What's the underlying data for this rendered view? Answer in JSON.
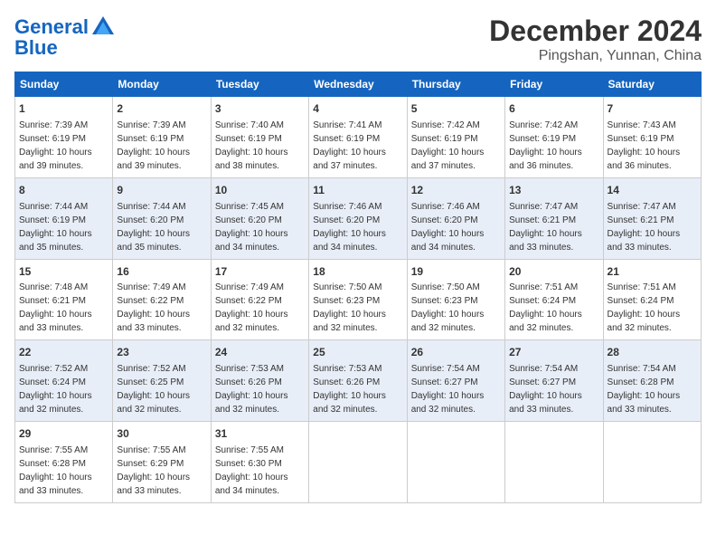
{
  "logo": {
    "line1": "General",
    "line2": "Blue"
  },
  "title": "December 2024",
  "subtitle": "Pingshan, Yunnan, China",
  "days_of_week": [
    "Sunday",
    "Monday",
    "Tuesday",
    "Wednesday",
    "Thursday",
    "Friday",
    "Saturday"
  ],
  "weeks": [
    [
      {
        "day": "1",
        "sunrise": "7:39 AM",
        "sunset": "6:19 PM",
        "daylight": "10 hours and 39 minutes."
      },
      {
        "day": "2",
        "sunrise": "7:39 AM",
        "sunset": "6:19 PM",
        "daylight": "10 hours and 39 minutes."
      },
      {
        "day": "3",
        "sunrise": "7:40 AM",
        "sunset": "6:19 PM",
        "daylight": "10 hours and 38 minutes."
      },
      {
        "day": "4",
        "sunrise": "7:41 AM",
        "sunset": "6:19 PM",
        "daylight": "10 hours and 37 minutes."
      },
      {
        "day": "5",
        "sunrise": "7:42 AM",
        "sunset": "6:19 PM",
        "daylight": "10 hours and 37 minutes."
      },
      {
        "day": "6",
        "sunrise": "7:42 AM",
        "sunset": "6:19 PM",
        "daylight": "10 hours and 36 minutes."
      },
      {
        "day": "7",
        "sunrise": "7:43 AM",
        "sunset": "6:19 PM",
        "daylight": "10 hours and 36 minutes."
      }
    ],
    [
      {
        "day": "8",
        "sunrise": "7:44 AM",
        "sunset": "6:19 PM",
        "daylight": "10 hours and 35 minutes."
      },
      {
        "day": "9",
        "sunrise": "7:44 AM",
        "sunset": "6:20 PM",
        "daylight": "10 hours and 35 minutes."
      },
      {
        "day": "10",
        "sunrise": "7:45 AM",
        "sunset": "6:20 PM",
        "daylight": "10 hours and 34 minutes."
      },
      {
        "day": "11",
        "sunrise": "7:46 AM",
        "sunset": "6:20 PM",
        "daylight": "10 hours and 34 minutes."
      },
      {
        "day": "12",
        "sunrise": "7:46 AM",
        "sunset": "6:20 PM",
        "daylight": "10 hours and 34 minutes."
      },
      {
        "day": "13",
        "sunrise": "7:47 AM",
        "sunset": "6:21 PM",
        "daylight": "10 hours and 33 minutes."
      },
      {
        "day": "14",
        "sunrise": "7:47 AM",
        "sunset": "6:21 PM",
        "daylight": "10 hours and 33 minutes."
      }
    ],
    [
      {
        "day": "15",
        "sunrise": "7:48 AM",
        "sunset": "6:21 PM",
        "daylight": "10 hours and 33 minutes."
      },
      {
        "day": "16",
        "sunrise": "7:49 AM",
        "sunset": "6:22 PM",
        "daylight": "10 hours and 33 minutes."
      },
      {
        "day": "17",
        "sunrise": "7:49 AM",
        "sunset": "6:22 PM",
        "daylight": "10 hours and 32 minutes."
      },
      {
        "day": "18",
        "sunrise": "7:50 AM",
        "sunset": "6:23 PM",
        "daylight": "10 hours and 32 minutes."
      },
      {
        "day": "19",
        "sunrise": "7:50 AM",
        "sunset": "6:23 PM",
        "daylight": "10 hours and 32 minutes."
      },
      {
        "day": "20",
        "sunrise": "7:51 AM",
        "sunset": "6:24 PM",
        "daylight": "10 hours and 32 minutes."
      },
      {
        "day": "21",
        "sunrise": "7:51 AM",
        "sunset": "6:24 PM",
        "daylight": "10 hours and 32 minutes."
      }
    ],
    [
      {
        "day": "22",
        "sunrise": "7:52 AM",
        "sunset": "6:24 PM",
        "daylight": "10 hours and 32 minutes."
      },
      {
        "day": "23",
        "sunrise": "7:52 AM",
        "sunset": "6:25 PM",
        "daylight": "10 hours and 32 minutes."
      },
      {
        "day": "24",
        "sunrise": "7:53 AM",
        "sunset": "6:26 PM",
        "daylight": "10 hours and 32 minutes."
      },
      {
        "day": "25",
        "sunrise": "7:53 AM",
        "sunset": "6:26 PM",
        "daylight": "10 hours and 32 minutes."
      },
      {
        "day": "26",
        "sunrise": "7:54 AM",
        "sunset": "6:27 PM",
        "daylight": "10 hours and 32 minutes."
      },
      {
        "day": "27",
        "sunrise": "7:54 AM",
        "sunset": "6:27 PM",
        "daylight": "10 hours and 33 minutes."
      },
      {
        "day": "28",
        "sunrise": "7:54 AM",
        "sunset": "6:28 PM",
        "daylight": "10 hours and 33 minutes."
      }
    ],
    [
      {
        "day": "29",
        "sunrise": "7:55 AM",
        "sunset": "6:28 PM",
        "daylight": "10 hours and 33 minutes."
      },
      {
        "day": "30",
        "sunrise": "7:55 AM",
        "sunset": "6:29 PM",
        "daylight": "10 hours and 33 minutes."
      },
      {
        "day": "31",
        "sunrise": "7:55 AM",
        "sunset": "6:30 PM",
        "daylight": "10 hours and 34 minutes."
      },
      null,
      null,
      null,
      null
    ]
  ]
}
